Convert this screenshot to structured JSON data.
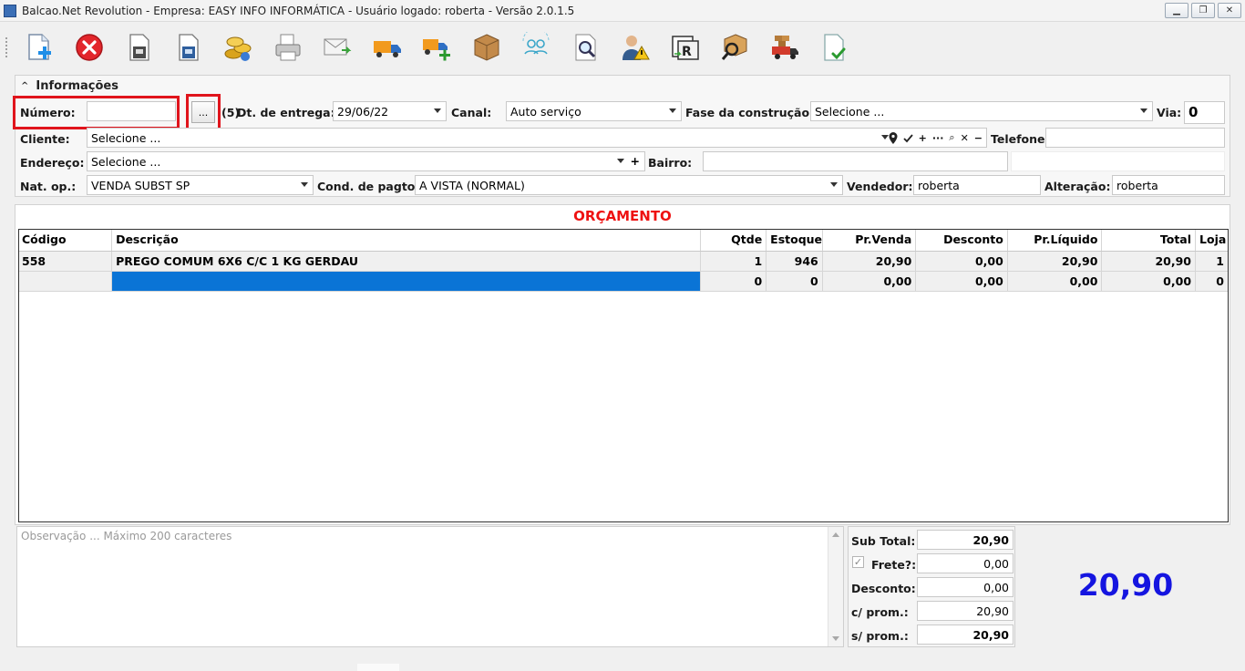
{
  "window": {
    "title": "Balcao.Net Revolution - Empresa: EASY INFO INFORMÁTICA - Usuário logado: roberta - Versão 2.0.1.5",
    "minimize_glyph": "▁",
    "restore_glyph": "❐",
    "close_glyph": "✕"
  },
  "toolbar": {
    "icons": [
      "new-document-icon",
      "cancel-icon",
      "save-icon",
      "save-as-icon",
      "coins-icon",
      "print-icon",
      "email-icon",
      "delivery-truck-icon",
      "add-delivery-icon",
      "package-box-icon",
      "sync-users-icon",
      "search-document-icon",
      "user-warning-icon",
      "report-icon",
      "package-search-icon",
      "cargo-truck-icon",
      "confirm-document-icon"
    ]
  },
  "info": {
    "header": "Informações",
    "caret": "^",
    "numero_label": "Número:",
    "numero_value": "",
    "ellipsis": "...",
    "hint": "(5)",
    "dt_entrega_label": "Dt. de entrega:",
    "dt_entrega_value": "29/06/22",
    "canal_label": "Canal:",
    "canal_value": "Auto serviço",
    "fase_label": "Fase da construção:",
    "fase_value": "Selecione ...",
    "via_label": "Via:",
    "via_value": "0",
    "cliente_label": "Cliente:",
    "cliente_value": "Selecione ...",
    "telefone_label": "Telefone",
    "telefone_value": "",
    "endereco_label": "Endereço:",
    "endereco_value": "Selecione ...",
    "bairro_label": "Bairro:",
    "bairro_value": "",
    "natop_label": "Nat. op.:",
    "natop_value": "VENDA SUBST SP",
    "cond_label": "Cond. de pagto:",
    "cond_value": "A VISTA (NORMAL)",
    "vendedor_label": "Vendedor:",
    "vendedor_value": "roberta",
    "alteracao_label": "Alteração:",
    "alteracao_value": "roberta",
    "tools": {
      "plus": "+",
      "dots": "···",
      "search": "⌕",
      "clear": "✕",
      "minus": "−"
    }
  },
  "grid": {
    "title": "ORÇAMENTO",
    "columns": [
      "Código",
      "Descrição",
      "Qtde",
      "Estoque",
      "Pr.Venda",
      "Desconto",
      "Pr.Líquido",
      "Total",
      "Loja"
    ],
    "rows": [
      [
        "558",
        "PREGO COMUM 6X6 C/C 1 KG GERDAU",
        "1",
        "946",
        "20,90",
        "0,00",
        "20,90",
        "20,90",
        "1"
      ],
      [
        "",
        "",
        "0",
        "0",
        "0,00",
        "0,00",
        "0,00",
        "0,00",
        "0"
      ]
    ]
  },
  "observacao": {
    "placeholder": "Observação ... Máximo 200 caracteres"
  },
  "totals": {
    "subtotal_label": "Sub Total:",
    "subtotal_value": "20,90",
    "frete_label": "Frete?:",
    "frete_value": "0,00",
    "frete_check": "✓",
    "desconto_label": "Desconto:",
    "desconto_value": "0,00",
    "cprom_label": "c/ prom.:",
    "cprom_value": "20,90",
    "sprom_label": "s/ prom.:",
    "sprom_value": "20,90",
    "big_total": "20,90"
  },
  "colors": {
    "accent": "#0a74d6",
    "title_red": "#e11111",
    "total_blue": "#1515e0",
    "highlight_red": "#e0141c"
  }
}
